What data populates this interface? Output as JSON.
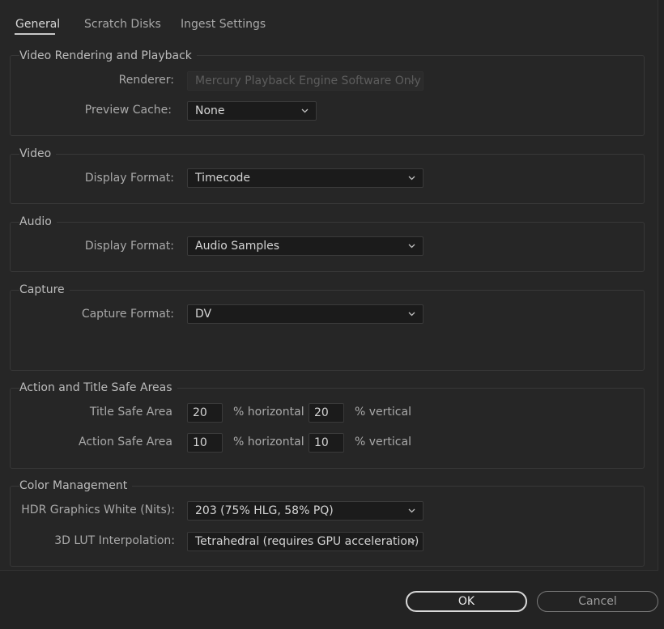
{
  "tabs": [
    {
      "label": "General",
      "active": true
    },
    {
      "label": "Scratch Disks",
      "active": false
    },
    {
      "label": "Ingest Settings",
      "active": false
    }
  ],
  "video_rendering": {
    "title": "Video Rendering and Playback",
    "renderer_label": "Renderer:",
    "renderer_value": "Mercury Playback Engine Software Only",
    "preview_cache_label": "Preview Cache:",
    "preview_cache_value": "None"
  },
  "video": {
    "title": "Video",
    "display_format_label": "Display Format:",
    "display_format_value": "Timecode"
  },
  "audio": {
    "title": "Audio",
    "display_format_label": "Display Format:",
    "display_format_value": "Audio Samples"
  },
  "capture": {
    "title": "Capture",
    "capture_format_label": "Capture Format:",
    "capture_format_value": "DV"
  },
  "safe_areas": {
    "title": "Action and Title Safe Areas",
    "title_safe_label": "Title Safe Area",
    "title_safe_horizontal": "20",
    "title_safe_vertical": "20",
    "action_safe_label": "Action Safe Area",
    "action_safe_horizontal": "10",
    "action_safe_vertical": "10",
    "horizontal_unit": "% horizontal",
    "vertical_unit": "% vertical"
  },
  "color_management": {
    "title": "Color Management",
    "hdr_white_label": "HDR Graphics White (Nits):",
    "hdr_white_value": "203 (75% HLG, 58% PQ)",
    "lut_label": "3D LUT Interpolation:",
    "lut_value": "Tetrahedral (requires GPU acceleration)"
  },
  "buttons": {
    "ok": "OK",
    "cancel": "Cancel"
  }
}
